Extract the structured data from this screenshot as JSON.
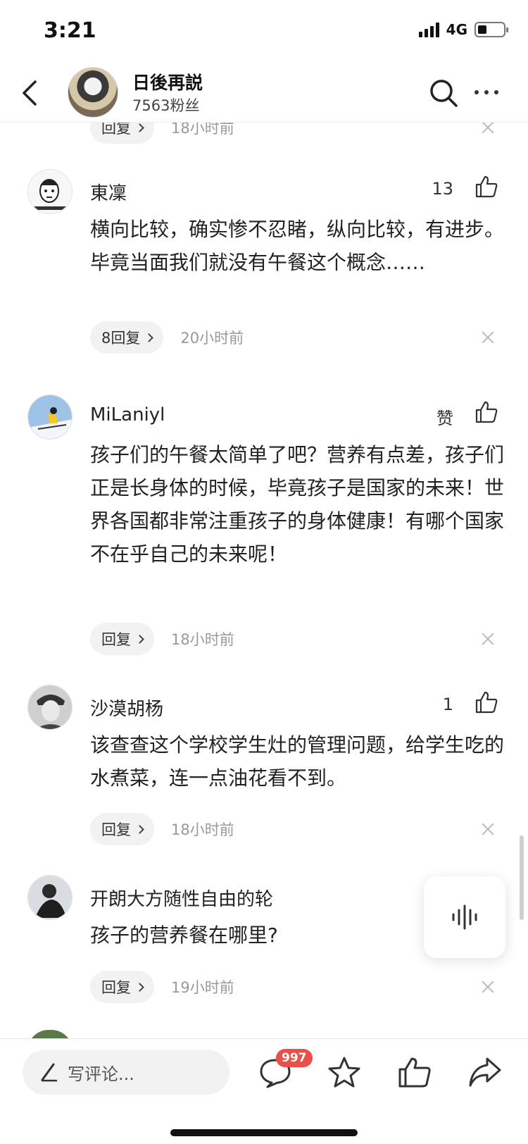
{
  "status": {
    "time": "3:21",
    "network": "4G"
  },
  "header": {
    "title": "日後再説",
    "followers": "7563粉丝"
  },
  "top_partial": {
    "reply_label": "回复",
    "time": "18小时前"
  },
  "comments": [
    {
      "name": "東凜",
      "likes": "13",
      "text": "横向比较，确实惨不忍睹，纵向比较，有进步。毕竟当面我们就没有午餐这个概念……",
      "reply_label": "8回复",
      "time": "20小时前"
    },
    {
      "name": "MiLaniyl",
      "likes": "赞",
      "text": "孩子们的午餐太简单了吧？营养有点差，孩子们正是长身体的时候，毕竟孩子是国家的未来！世界各国都非常注重孩子的身体健康！有哪个国家不在乎自己的未来呢！",
      "reply_label": "回复",
      "time": "18小时前"
    },
    {
      "name": "沙漠胡杨",
      "likes": "1",
      "text": "该查查这个学校学生灶的管理问题，给学生吃的水煮菜，连一点油花看不到。",
      "reply_label": "回复",
      "time": "18小时前"
    },
    {
      "name": "开朗大方随性自由的轮",
      "likes": "",
      "text": "孩子的营养餐在哪里?",
      "reply_label": "回复",
      "time": "19小时前"
    }
  ],
  "bottom_bar": {
    "input_placeholder": "写评论...",
    "comment_badge": "997"
  },
  "icons": {
    "back": "chevron-left-icon",
    "search": "search-icon",
    "more": "more-dots-icon",
    "like": "thumbs-up-icon",
    "close": "close-icon",
    "voice": "voice-wave-icon",
    "pen": "pen-icon",
    "comment": "speech-bubble-icon",
    "star": "star-icon",
    "share": "share-arrow-icon"
  }
}
